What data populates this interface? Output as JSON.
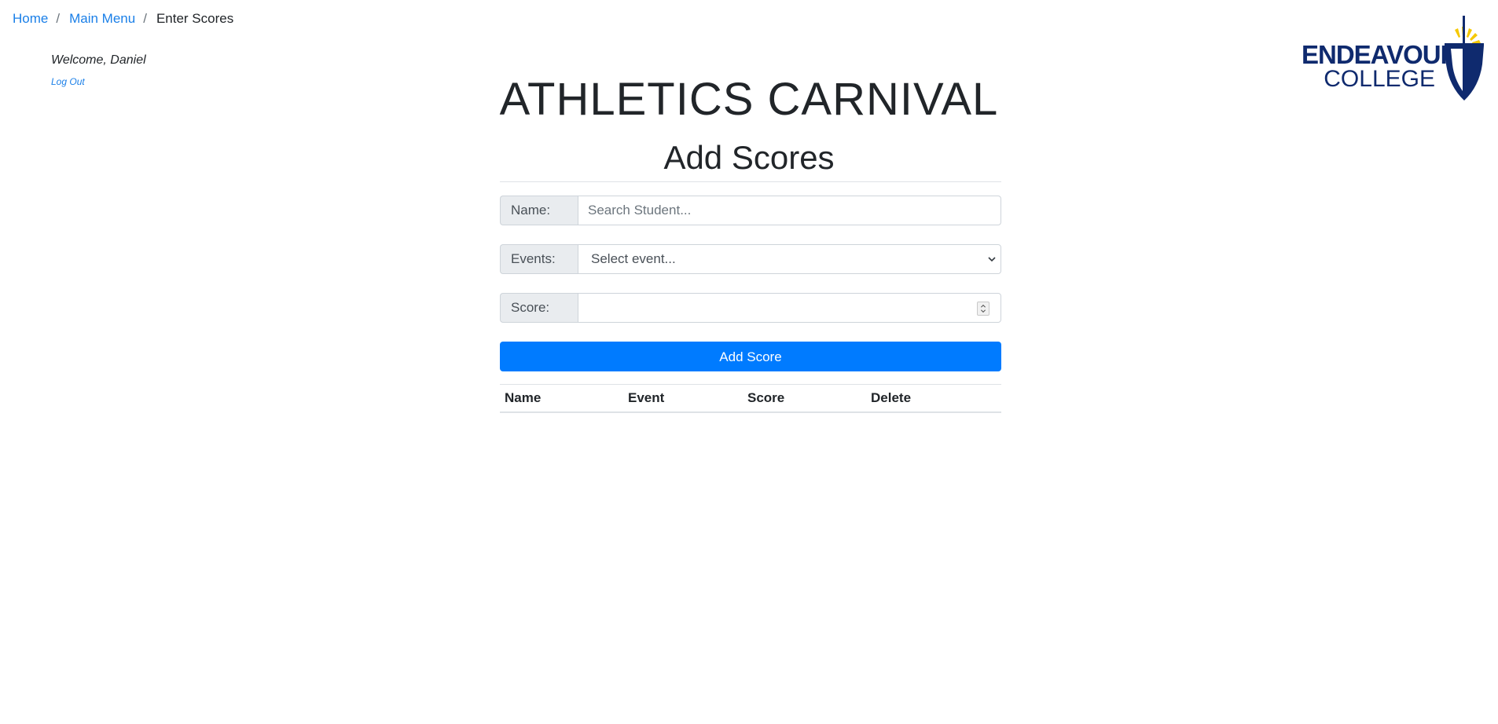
{
  "breadcrumb": {
    "items": [
      {
        "label": "Home",
        "link": true
      },
      {
        "label": "Main Menu",
        "link": true
      },
      {
        "label": "Enter Scores",
        "link": false
      }
    ],
    "separator": "/"
  },
  "user": {
    "welcome": "Welcome, Daniel",
    "logout_label": "Log Out"
  },
  "logo": {
    "line1": "ENDEAVOUR",
    "line2": "COLLEGE",
    "colors": {
      "navy": "#0f2a6e",
      "gold": "#f5c800"
    }
  },
  "header": {
    "title": "ATHLETICS CARNIVAL",
    "subtitle": "Add Scores"
  },
  "form": {
    "name": {
      "label": "Name:",
      "placeholder": "Search Student...",
      "value": ""
    },
    "events": {
      "label": "Events:",
      "selected": "Select event..."
    },
    "score": {
      "label": "Score:",
      "value": ""
    },
    "submit_label": "Add Score"
  },
  "table": {
    "columns": [
      "Name",
      "Event",
      "Score",
      "Delete"
    ],
    "rows": []
  },
  "colors": {
    "primary": "#007bff",
    "link": "#1a7fe8",
    "addon_bg": "#e9ecef",
    "border": "#ced4da"
  }
}
